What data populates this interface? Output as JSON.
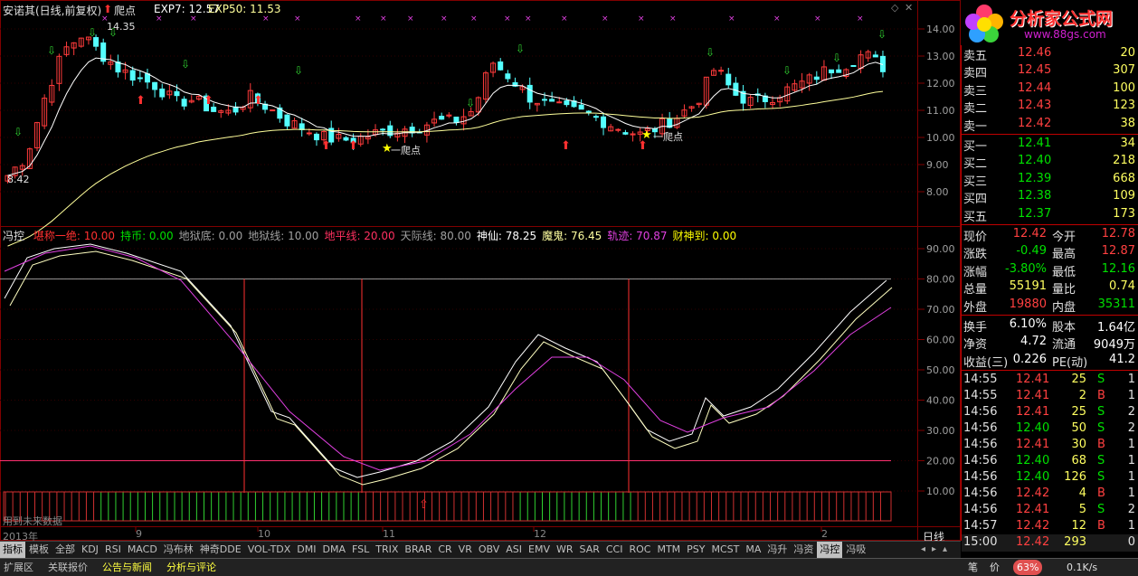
{
  "header": {
    "stock_name": "安诺其(日线,前复权)",
    "signal_label": "爬点",
    "exp7": "EXP7: 12.57",
    "exp50": "EXP50: 11.53",
    "high_label": "14.35",
    "low_label": "8.42",
    "star_label": "一爬点"
  },
  "price_axis": [
    "14.00",
    "13.00",
    "12.00",
    "11.00",
    "10.00",
    "9.00",
    "8.00"
  ],
  "indicator_header": {
    "name": "冯控",
    "items": [
      {
        "text": "堪称一绝: 10.00",
        "color": "#ff3030"
      },
      {
        "text": "持币: 0.00",
        "color": "#00e000"
      },
      {
        "text": "地狱底: 0.00",
        "color": "#a0a0a0"
      },
      {
        "text": "地狱线: 10.00",
        "color": "#a0a0a0"
      },
      {
        "text": "地平线: 20.00",
        "color": "#ff3060"
      },
      {
        "text": "天际线: 80.00",
        "color": "#a0a0a0"
      },
      {
        "text": "神仙: 78.25",
        "color": "#ffffff"
      },
      {
        "text": "魔鬼: 76.45",
        "color": "#ffffa0"
      },
      {
        "text": "轨迹: 70.87",
        "color": "#e040e0"
      },
      {
        "text": "财神到: 0.00",
        "color": "#ffff00"
      }
    ]
  },
  "ind_axis": [
    "90.00",
    "80.00",
    "70.00",
    "60.00",
    "50.00",
    "40.00",
    "30.00",
    "20.00",
    "10.00"
  ],
  "no_data_text": "用到未来数据",
  "date_axis": {
    "year": "2013年",
    "months": [
      "9",
      "10",
      "11",
      "12",
      "2"
    ],
    "mode": "日线"
  },
  "watermark": {
    "text": "分析家公式网",
    "url": "www.88gs.com"
  },
  "order_book": {
    "asks": [
      {
        "label": "卖五",
        "price": "12.46",
        "vol": "20"
      },
      {
        "label": "卖四",
        "price": "12.45",
        "vol": "307"
      },
      {
        "label": "卖三",
        "price": "12.44",
        "vol": "100"
      },
      {
        "label": "卖二",
        "price": "12.43",
        "vol": "123"
      },
      {
        "label": "卖一",
        "price": "12.42",
        "vol": "38"
      }
    ],
    "bids": [
      {
        "label": "买一",
        "price": "12.41",
        "vol": "34"
      },
      {
        "label": "买二",
        "price": "12.40",
        "vol": "218"
      },
      {
        "label": "买三",
        "price": "12.39",
        "vol": "668"
      },
      {
        "label": "买四",
        "price": "12.38",
        "vol": "109"
      },
      {
        "label": "买五",
        "price": "12.37",
        "vol": "173"
      }
    ]
  },
  "quote": [
    {
      "l1": "现价",
      "v1": "12.42",
      "c1": "#ff4040",
      "l2": "今开",
      "v2": "12.78",
      "c2": "#ff4040"
    },
    {
      "l1": "涨跌",
      "v1": "-0.49",
      "c1": "#00e000",
      "l2": "最高",
      "v2": "12.87",
      "c2": "#ff4040"
    },
    {
      "l1": "涨幅",
      "v1": "-3.80%",
      "c1": "#00e000",
      "l2": "最低",
      "v2": "12.16",
      "c2": "#00e000"
    },
    {
      "l1": "总量",
      "v1": "55191",
      "c1": "#ffff60",
      "l2": "量比",
      "v2": "0.74",
      "c2": "#ffff60"
    },
    {
      "l1": "外盘",
      "v1": "19880",
      "c1": "#ff4040",
      "l2": "内盘",
      "v2": "35311",
      "c2": "#00e000"
    }
  ],
  "fundamentals": [
    {
      "l1": "换手",
      "v1": "6.10%",
      "l2": "股本",
      "v2": "1.64亿"
    },
    {
      "l1": "净资",
      "v1": "4.72",
      "l2": "流通",
      "v2": "9049万"
    },
    {
      "l1": "收益(三)",
      "v1": "0.226",
      "l2": "PE(动)",
      "v2": "41.2"
    }
  ],
  "ticks": [
    {
      "t": "14:55",
      "p": "12.41",
      "v": "25",
      "s": "S",
      "n": "1"
    },
    {
      "t": "14:55",
      "p": "12.41",
      "v": "2",
      "s": "B",
      "n": "1"
    },
    {
      "t": "14:56",
      "p": "12.41",
      "v": "25",
      "s": "S",
      "n": "2"
    },
    {
      "t": "14:56",
      "p": "12.40",
      "v": "50",
      "s": "S",
      "n": "2"
    },
    {
      "t": "14:56",
      "p": "12.41",
      "v": "30",
      "s": "B",
      "n": "1"
    },
    {
      "t": "14:56",
      "p": "12.40",
      "v": "68",
      "s": "S",
      "n": "1"
    },
    {
      "t": "14:56",
      "p": "12.40",
      "v": "126",
      "s": "S",
      "n": "1"
    },
    {
      "t": "14:56",
      "p": "12.42",
      "v": "4",
      "s": "B",
      "n": "1"
    },
    {
      "t": "14:56",
      "p": "12.41",
      "v": "5",
      "s": "S",
      "n": "2"
    },
    {
      "t": "14:57",
      "p": "12.42",
      "v": "12",
      "s": "B",
      "n": "1"
    },
    {
      "t": "15:00",
      "p": "12.42",
      "v": "293",
      "s": "",
      "n": "0"
    }
  ],
  "indicator_tabs": [
    "指标",
    "模板",
    "全部",
    "KDJ",
    "RSI",
    "MACD",
    "冯布林",
    "神奇DDE",
    "VOL-TDX",
    "DMI",
    "DMA",
    "FSL",
    "TRIX",
    "BRAR",
    "CR",
    "VR",
    "OBV",
    "ASI",
    "EMV",
    "WR",
    "SAR",
    "CCI",
    "ROC",
    "MTM",
    "PSY",
    "MCST",
    "MA",
    "冯升",
    "冯资",
    "冯控",
    "冯吸"
  ],
  "active_tab": "冯控",
  "bottom_tabs": [
    {
      "text": "扩展区",
      "color": "#c0c0c0"
    },
    {
      "text": "关联报价",
      "color": "#c0c0c0"
    },
    {
      "text": "公告与新闻",
      "color": "#ffff40"
    },
    {
      "text": "分析与评论",
      "color": "#ffff40"
    }
  ],
  "status": {
    "mode": "笔",
    "price": "价",
    "pct": "63%",
    "speed": "0.1K/s"
  },
  "colors": {
    "up": "#ff3b3b",
    "down": "#54ffff",
    "exp7": "#ffffff",
    "exp50": "#ffff9b",
    "k": "#ffffff",
    "d": "#ffffc0",
    "j": "#e040e0",
    "grid": "#800000"
  },
  "chart_data": {
    "type": "candlestick",
    "exp7_last": 12.57,
    "exp50_last": 11.53,
    "high": 14.35,
    "low": 8.42,
    "last": 12.42
  }
}
